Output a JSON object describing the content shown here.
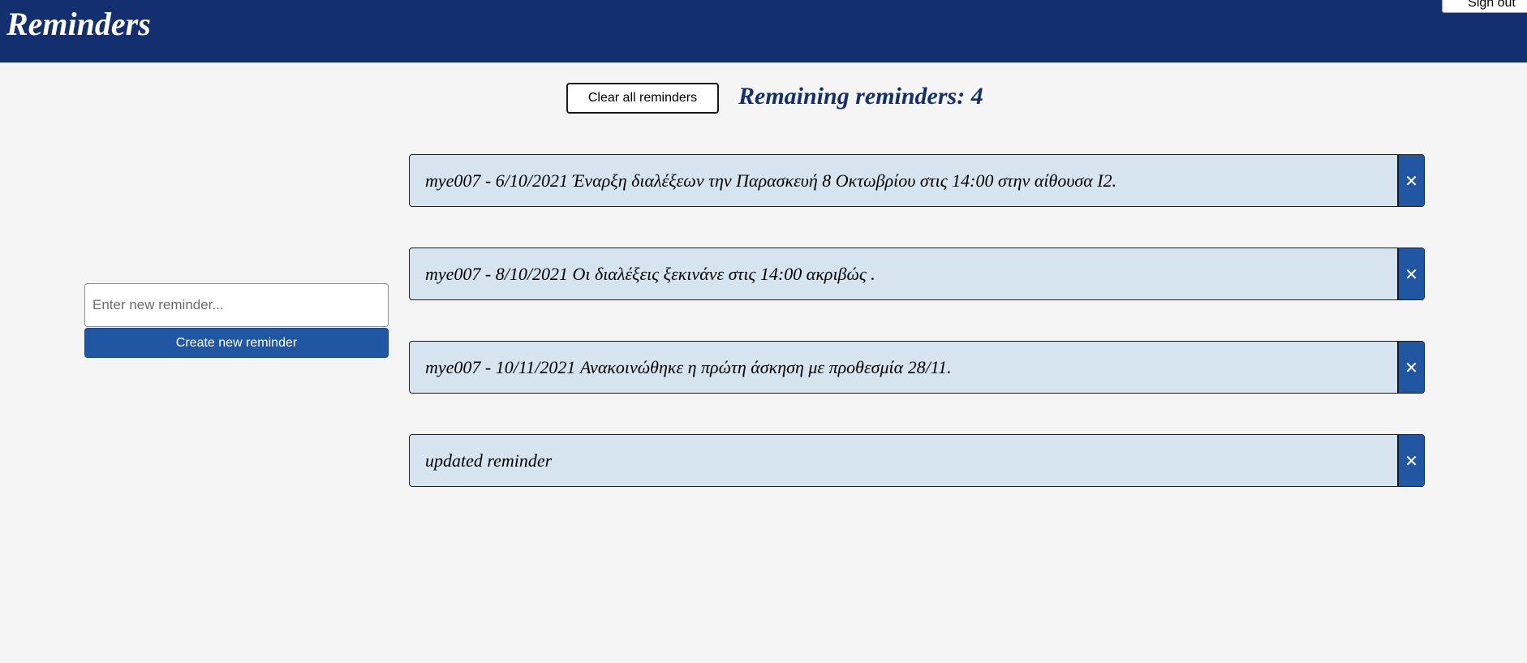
{
  "header": {
    "title": "Reminders",
    "signout_label": "Sign out"
  },
  "toolbar": {
    "clear_label": "Clear all reminders",
    "remaining_text": "Remaining reminders: 4"
  },
  "form": {
    "input_placeholder": "Enter new reminder...",
    "input_value": "",
    "create_label": "Create new reminder"
  },
  "reminders": [
    {
      "text": "mye007 - 6/10/2021 Έναρξη διαλέξεων την Παρασκευή 8 Οκτωβρίου στις 14:00 στην αίθουσα Ι2.",
      "delete_glyph": "✕"
    },
    {
      "text": "mye007 - 8/10/2021 Οι διαλέξεις ξεκινάνε στις 14:00 ακριβώς .",
      "delete_glyph": "✕"
    },
    {
      "text": "mye007 - 10/11/2021 Ανακοινώθηκε η πρώτη άσκηση με προθεσμία 28/11.",
      "delete_glyph": "✕"
    },
    {
      "text": "updated reminder",
      "delete_glyph": "✕"
    }
  ],
  "colors": {
    "header_bg": "#142f70",
    "accent": "#2156a3",
    "reminder_bg": "#d6e4f0",
    "page_bg": "#f5f5f5"
  }
}
